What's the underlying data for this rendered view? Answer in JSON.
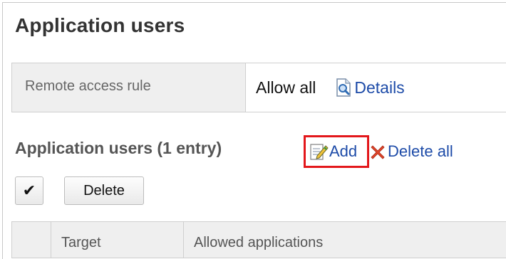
{
  "page": {
    "title": "Application users"
  },
  "remote_access": {
    "label": "Remote access rule",
    "value": "Allow all",
    "details_link": "Details"
  },
  "users_section": {
    "title": "Application users (1 entry)",
    "add_label": "Add",
    "delete_all_label": "Delete all",
    "highlight_color": "#e3171b"
  },
  "toolbar": {
    "check_label": "✔",
    "delete_label": "Delete"
  },
  "table": {
    "columns": [
      "",
      "Target",
      "Allowed applications"
    ]
  },
  "colors": {
    "link": "#1d4ba8",
    "header_bg": "#efefef"
  }
}
